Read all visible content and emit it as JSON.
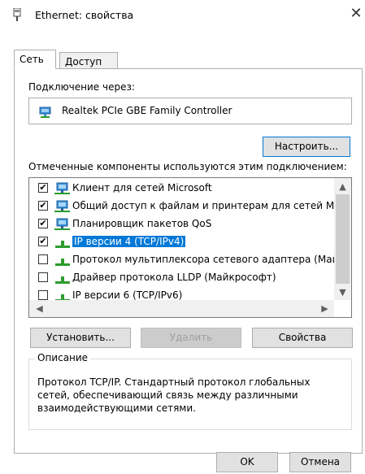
{
  "window": {
    "title": "Ethernet: свойства",
    "close_glyph": "✕"
  },
  "tabs": [
    {
      "label": "Сеть",
      "active": true
    },
    {
      "label": "Доступ",
      "active": false
    }
  ],
  "connect_via": {
    "label": "Подключение через:",
    "adapter": "Realtek PCIe GBE Family Controller",
    "icon": "network-adapter-icon"
  },
  "configure_button": "Настроить...",
  "components_label": "Отмеченные компоненты используются этим подключением:",
  "components": [
    {
      "label": "Клиент для сетей Microsoft",
      "checked": true,
      "icon": "network-client-icon",
      "selected": false
    },
    {
      "label": "Общий доступ к файлам и принтерам для сетей Mi",
      "checked": true,
      "icon": "network-client-icon",
      "selected": false
    },
    {
      "label": "Планировщик пакетов QoS",
      "checked": true,
      "icon": "network-client-icon",
      "selected": false
    },
    {
      "label": "IP версии 4 (TCP/IPv4)",
      "checked": true,
      "icon": "protocol-icon",
      "selected": true
    },
    {
      "label": "Протокол мультиплексора сетевого адаптера (Май",
      "checked": false,
      "icon": "protocol-icon",
      "selected": false
    },
    {
      "label": "Драйвер протокола LLDP (Майкрософт)",
      "checked": false,
      "icon": "protocol-icon",
      "selected": false
    },
    {
      "label": "IP версии 6 (TCP/IPv6)",
      "checked": false,
      "icon": "protocol-icon",
      "selected": false
    }
  ],
  "buttons": {
    "install": "Установить...",
    "remove": "Удалить",
    "properties": "Свойства"
  },
  "description": {
    "legend": "Описание",
    "text": "Протокол TCP/IP. Стандартный протокол глобальных сетей, обеспечивающий связь между различными взаимодействующими сетями."
  },
  "footer": {
    "ok": "OK",
    "cancel": "Отмена"
  },
  "colors": {
    "selection": "#0078d7",
    "button_face": "#e1e1e1",
    "border": "#adadad"
  }
}
